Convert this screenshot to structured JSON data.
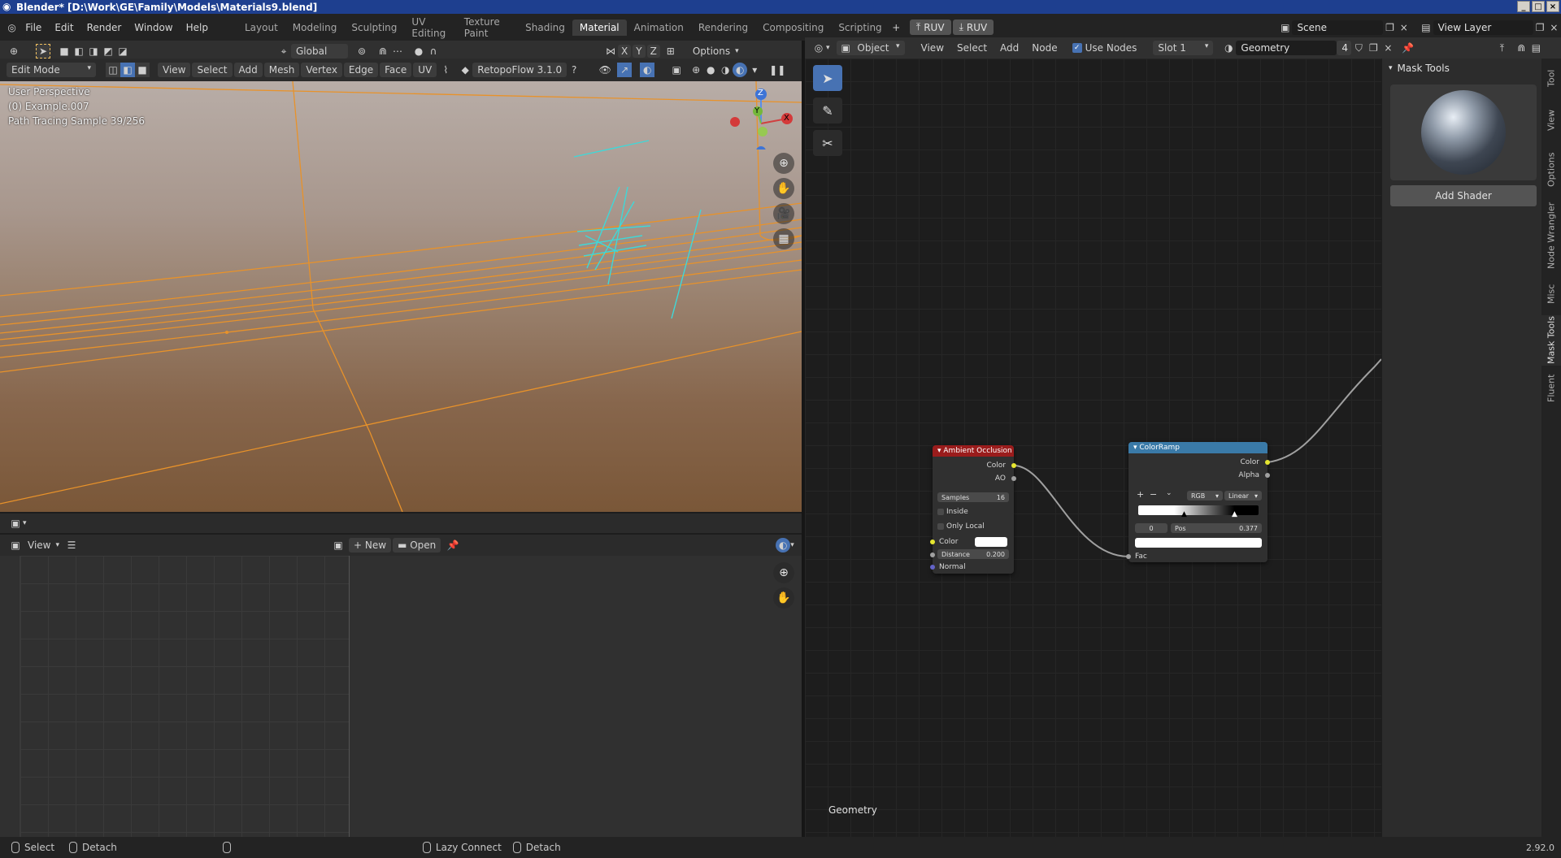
{
  "window": {
    "title": "Blender* [D:\\Work\\GE\\Family\\Models\\Materials9.blend]"
  },
  "menu": [
    "File",
    "Edit",
    "Render",
    "Window",
    "Help"
  ],
  "workspaces": [
    {
      "label": "Layout",
      "active": false
    },
    {
      "label": "Modeling",
      "active": false
    },
    {
      "label": "Sculpting",
      "active": false
    },
    {
      "label": "UV Editing",
      "active": false
    },
    {
      "label": "Texture Paint",
      "active": false
    },
    {
      "label": "Shading",
      "active": false
    },
    {
      "label": "Material",
      "active": true
    },
    {
      "label": "Animation",
      "active": false
    },
    {
      "label": "Rendering",
      "active": false
    },
    {
      "label": "Compositing",
      "active": false
    },
    {
      "label": "Scripting",
      "active": false
    }
  ],
  "topbar": {
    "ruv1": "RUV",
    "ruv2": "RUV",
    "scene": "Scene",
    "view_layer": "View Layer"
  },
  "viewport_tools": {
    "orientation": "Global",
    "options": "Options",
    "axes": [
      "X",
      "Y",
      "Z"
    ]
  },
  "viewport_header": {
    "mode": "Edit Mode",
    "menus": [
      "View",
      "Select",
      "Add",
      "Mesh",
      "Vertex",
      "Edge",
      "Face",
      "UV"
    ],
    "addon": "RetopoFlow 3.1.0"
  },
  "viewport": {
    "perspective": "User Perspective",
    "object": "(0) Example.007",
    "render_status": "Path Tracing Sample 39/256",
    "gizmo": {
      "z": "Z",
      "y": "Y",
      "x": "X"
    }
  },
  "image_editor": {
    "view": "View",
    "new": "New",
    "open": "Open"
  },
  "node_header": {
    "object": "Object",
    "menus": [
      "View",
      "Select",
      "Add",
      "Node"
    ],
    "use_nodes": "Use Nodes",
    "slot": "Slot 1",
    "material": "Geometry",
    "users": "4"
  },
  "nodes": {
    "ao": {
      "title": "Ambient Occlusion",
      "out_color": "Color",
      "out_ao": "AO",
      "samples_label": "Samples",
      "samples_value": "16",
      "inside": "Inside",
      "only_local": "Only Local",
      "in_color": "Color",
      "distance_label": "Distance",
      "distance_value": "0.200",
      "normal": "Normal"
    },
    "ramp": {
      "title": "ColorRamp",
      "out_color": "Color",
      "out_alpha": "Alpha",
      "mode": "RGB",
      "interp": "Linear",
      "index": "0",
      "pos_label": "Pos",
      "pos_value": "0.377",
      "fac": "Fac"
    },
    "material_name": "Geometry"
  },
  "sidebar": {
    "panel_title": "Mask Tools",
    "add_shader": "Add Shader",
    "tabs": [
      {
        "label": "Tool",
        "active": false
      },
      {
        "label": "View",
        "active": false
      },
      {
        "label": "Options",
        "active": false
      },
      {
        "label": "Node Wrangler",
        "active": false
      },
      {
        "label": "Misc",
        "active": false
      },
      {
        "label": "Mask Tools",
        "active": true
      },
      {
        "label": "Fluent",
        "active": false
      }
    ]
  },
  "statusbar": {
    "select": "Select",
    "detach1": "Detach",
    "lazy_connect": "Lazy Connect",
    "detach2": "Detach",
    "version": "2.92.0"
  },
  "colors": {
    "accent": "#4772b3",
    "ao_header": "#9a1c1c",
    "ramp_header": "#3a7aa8",
    "wire_orange": "#e8922a",
    "stroke_cyan": "#3fd8d8"
  }
}
